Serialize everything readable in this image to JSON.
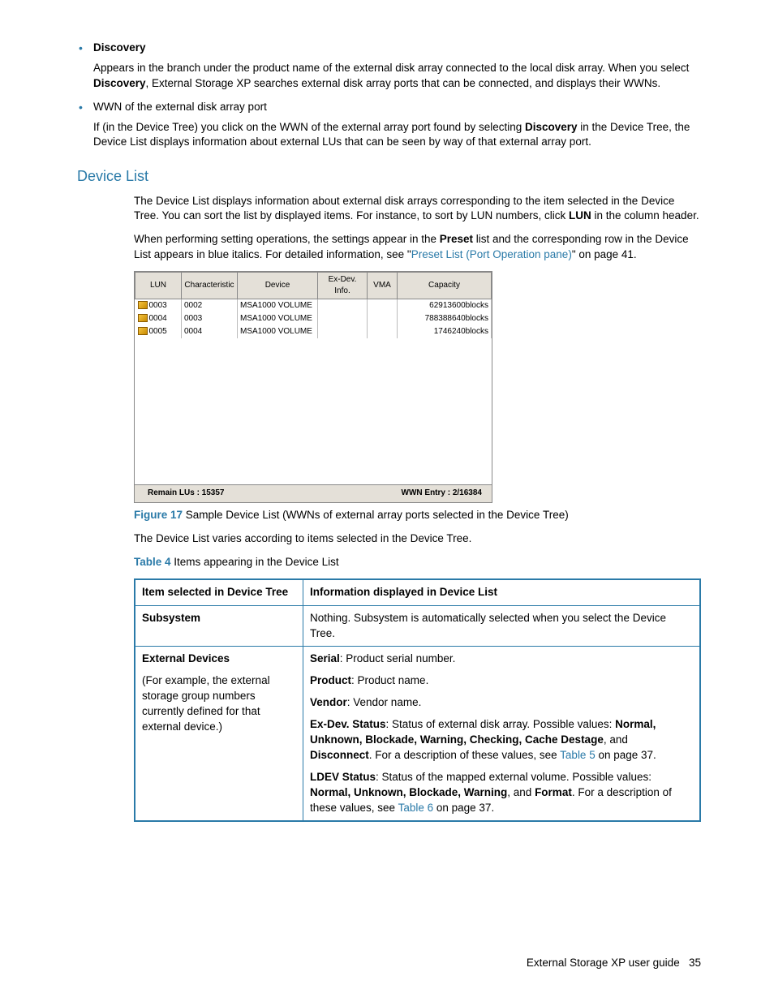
{
  "bullets": {
    "discovery_label": "Discovery",
    "discovery_text_1": "Appears in the branch under the product name of the external disk array connected to the local disk array. When you select ",
    "discovery_text_bold": "Discovery",
    "discovery_text_2": ", External Storage XP searches external disk array ports that can be connected, and displays their WWNs.",
    "wwn_label": "WWN of the external disk array port",
    "wwn_text_1": "If (in the Device Tree) you click on the WWN of the external array port found by selecting ",
    "wwn_text_bold": "Discovery",
    "wwn_text_2": " in the Device Tree, the Device List displays information about external LUs that can be seen by way of that external array port."
  },
  "heading_device_list": "Device List",
  "p1a": "The Device List displays information about external disk arrays corresponding to the item selected in the Device Tree. You can sort the list by displayed items. For instance, to sort by LUN numbers, click ",
  "p1_bold": "LUN",
  "p1b": " in the column header.",
  "p2a": "When performing setting operations, the settings appear in the ",
  "p2_bold": "Preset",
  "p2b": " list and the corresponding row in the Device List appears in blue italics. For detailed information, see \"",
  "p2_link": "Preset List (Port Operation pane)",
  "p2c": "\" on page 41.",
  "device_list": {
    "headers": [
      "LUN",
      "Characteristic",
      "Device",
      "Ex-Dev. Info.",
      "VMA",
      "Capacity"
    ],
    "rows": [
      {
        "lun": "0003",
        "char": "0002",
        "device": "MSA1000 VOLUME",
        "exdev": "",
        "vma": "",
        "cap": "62913600blocks"
      },
      {
        "lun": "0004",
        "char": "0003",
        "device": "MSA1000 VOLUME",
        "exdev": "",
        "vma": "",
        "cap": "788388640blocks"
      },
      {
        "lun": "0005",
        "char": "0004",
        "device": "MSA1000 VOLUME",
        "exdev": "",
        "vma": "",
        "cap": "1746240blocks"
      }
    ],
    "footer_left": "Remain LUs : 15357",
    "footer_right": "WWN Entry : 2/16384"
  },
  "figure17_label": "Figure 17",
  "figure17_text": "  Sample Device List (WWNs of external array ports selected in the Device Tree)",
  "p3": "The Device List varies according to items selected in the Device Tree.",
  "table4_label": "Table 4",
  "table4_title": "   Items appearing in the Device List",
  "table4": {
    "h1": "Item selected in Device Tree",
    "h2": "Information displayed in Device List",
    "r1c1": "Subsystem",
    "r1c2": "Nothing. Subsystem is automatically selected when you select the Device Tree.",
    "r2c1_bold": "External Devices",
    "r2c1_text": "(For example, the external storage group numbers currently defined for that external device.)",
    "r2_serial_b": "Serial",
    "r2_serial_t": ": Product serial number.",
    "r2_product_b": "Product",
    "r2_product_t": ": Product name.",
    "r2_vendor_b": "Vendor",
    "r2_vendor_t": ": Vendor name.",
    "r2_exdev_b": "Ex-Dev. Status",
    "r2_exdev_t": ": Status of external disk array. Possible values: ",
    "r2_exdev_vals": "Normal, Unknown, Blockade, Warning, Checking, Cache Destage",
    "r2_exdev_and": ", and ",
    "r2_exdev_disc": "Disconnect",
    "r2_exdev_end": ". For a description of these values, see ",
    "r2_exdev_link": "Table 5",
    "r2_exdev_page": " on page 37.",
    "r2_ldev_b": "LDEV Status",
    "r2_ldev_t": ": Status of the mapped external volume. Possible values: ",
    "r2_ldev_vals": "Normal, Unknown, Blockade, Warning",
    "r2_ldev_and": ", and ",
    "r2_ldev_fmt": "Format",
    "r2_ldev_end": ". For a description of these values, see ",
    "r2_ldev_link": "Table 6",
    "r2_ldev_page": " on page 37."
  },
  "footer_text": "External Storage XP user guide",
  "page_number": "35"
}
